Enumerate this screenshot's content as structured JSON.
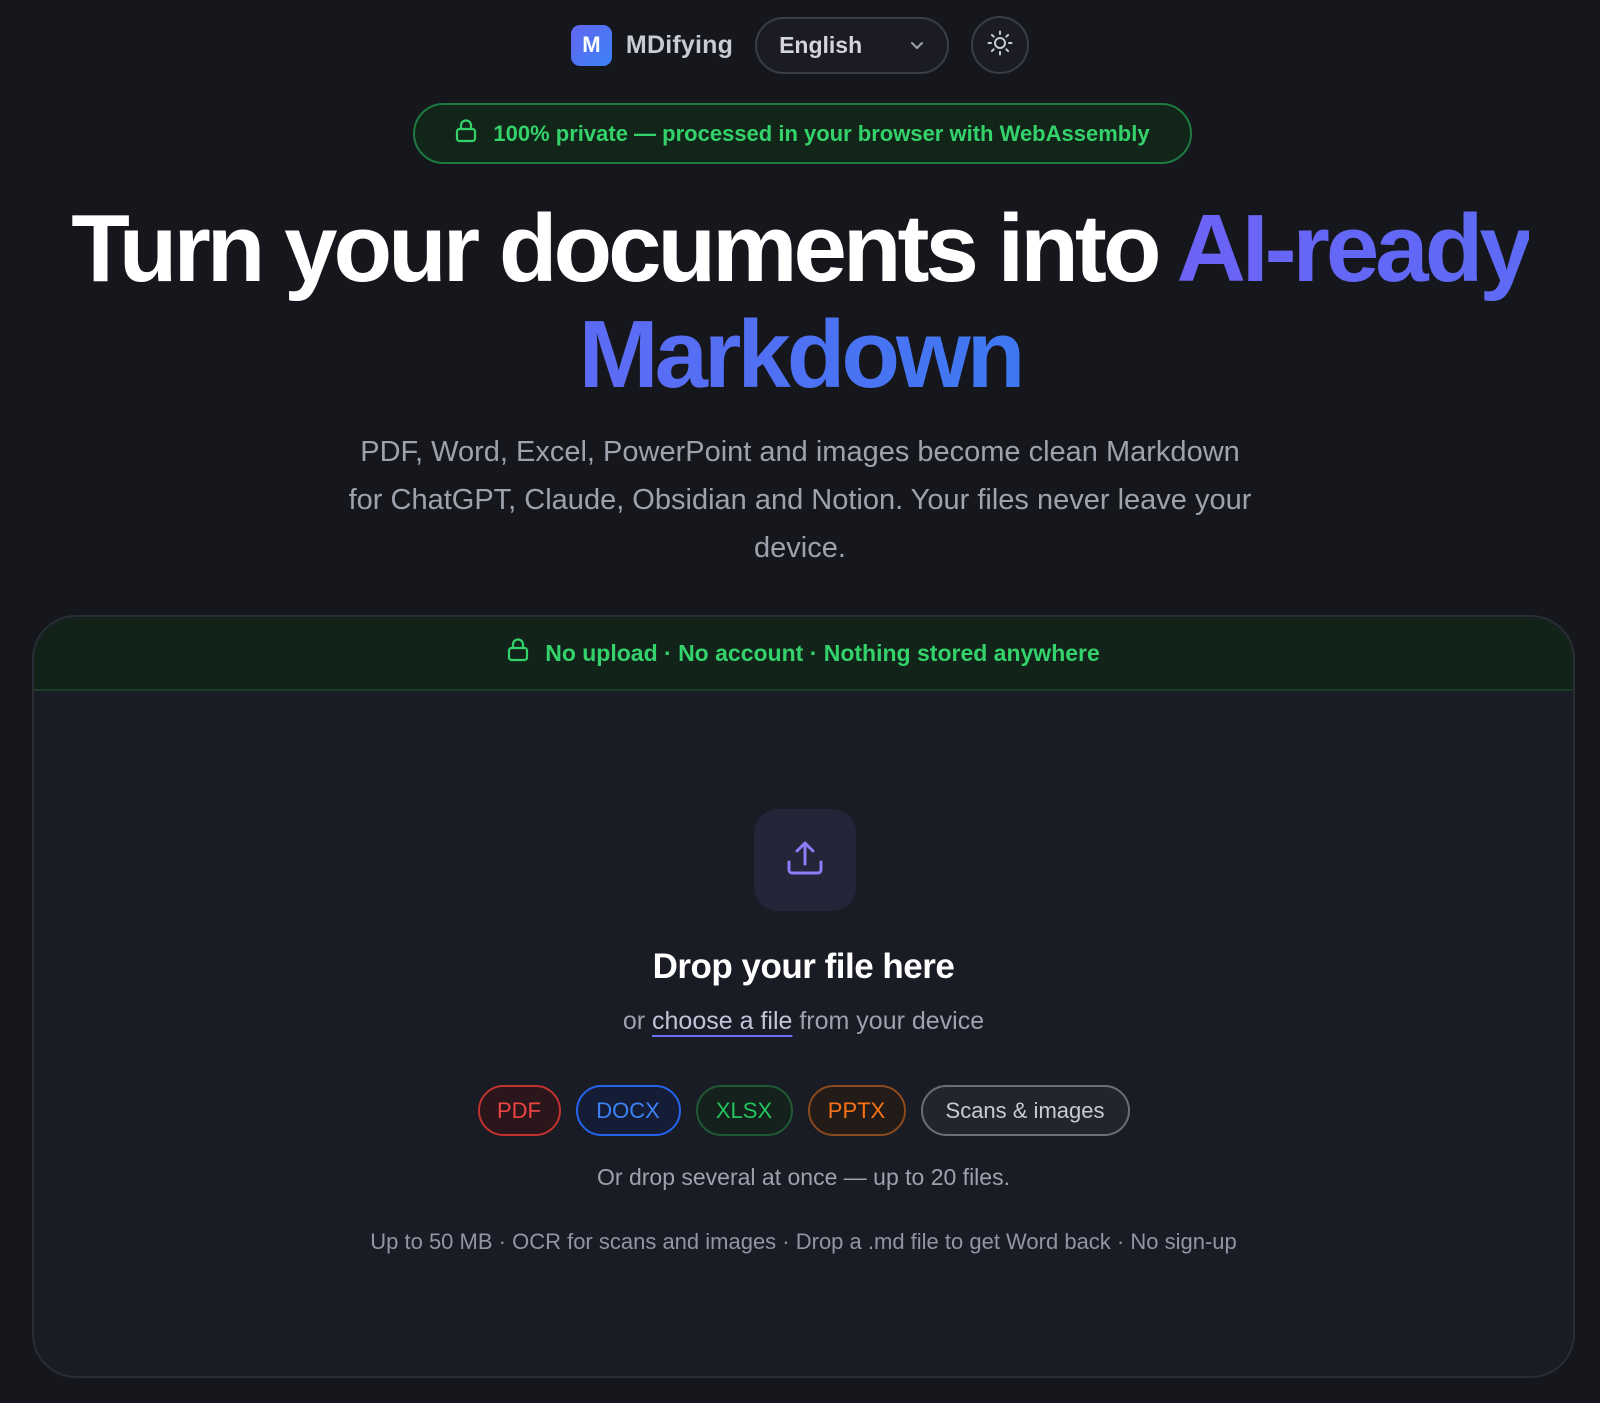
{
  "header": {
    "logo_letter": "M",
    "brand_name": "MDifying",
    "language": "English",
    "theme_toggle_icon": "sun-icon"
  },
  "privacy_pill": {
    "text": "100% private — processed in your browser with WebAssembly",
    "icon": "lock-icon"
  },
  "hero": {
    "title_plain": "Turn your documents into ",
    "title_accent": "AI-ready Markdown",
    "subtitle": "PDF, Word, Excel, PowerPoint and images become clean Markdown for ChatGPT, Claude, Obsidian and Notion. Your files never leave your device."
  },
  "dropzone": {
    "banner": "No upload · No account · Nothing stored anywhere",
    "banner_icon": "lock-icon",
    "upload_icon": "upload-icon",
    "heading": "Drop your file here",
    "sub_prefix": "or ",
    "sub_link": "choose a file",
    "sub_suffix": " from your device",
    "formats": [
      "PDF",
      "DOCX",
      "XLSX",
      "PPTX",
      "Scans & images"
    ],
    "multi_note": "Or drop several at once — up to 20 files.",
    "footer": "Up to 50 MB · OCR for scans and images · Drop a .md file to get Word back · No sign-up"
  },
  "colors": {
    "background": "#16171d",
    "accent_purple": "#6c63f6",
    "accent_blue": "#3d78f2",
    "privacy_green": "#34d26b",
    "pdf": "#ef4444",
    "docx": "#3b82f6",
    "xlsx": "#22c55e",
    "pptx": "#f97316"
  }
}
